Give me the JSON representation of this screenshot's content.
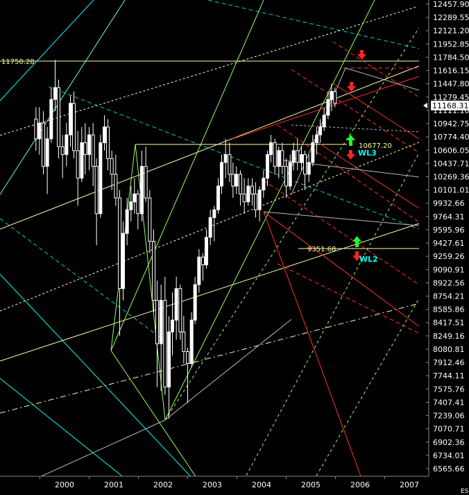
{
  "chart_data": {
    "type": "candlestick",
    "symbol": "ES",
    "y_ticks": [
      "12457.90",
      "12289.55",
      "12121.20",
      "11952.85",
      "11784.50",
      "11616.15",
      "11447.80",
      "11279.45",
      "11111.10",
      "10942.75",
      "10774.40",
      "10606.05",
      "10437.71",
      "10269.36",
      "10101.01",
      "9932.66",
      "9764.31",
      "9595.96",
      "9427.61",
      "9259.26",
      "9090.91",
      "8922.56",
      "8754.21",
      "8585.86",
      "8417.51",
      "8249.16",
      "8080.81",
      "7912.46",
      "7744.11",
      "7575.76",
      "7407.41",
      "7239.06",
      "7070.71",
      "6902.36",
      "6734.01",
      "6565.66"
    ],
    "x_ticks": [
      "2000",
      "2001",
      "2002",
      "2003",
      "2004",
      "2005",
      "2006",
      "2007"
    ],
    "ylim": [
      6565.66,
      12457.9
    ],
    "current_price": "11168.31",
    "levels": [
      {
        "label": "11750.28",
        "value": 11750.28
      },
      {
        "label": "10677.20",
        "value": 10677.2
      },
      {
        "label": "9351.68",
        "value": 9351.68
      }
    ],
    "wave_labels": [
      "WL3",
      "WL2"
    ],
    "candles": [
      [
        1999.92,
        11000,
        11150,
        10600,
        10750
      ],
      [
        1999.99,
        10750,
        11150,
        10550,
        10950
      ],
      [
        2000.07,
        10950,
        11100,
        10300,
        10400
      ],
      [
        2000.15,
        10400,
        10900,
        10050,
        10750
      ],
      [
        2000.23,
        10750,
        11400,
        10700,
        11250
      ],
      [
        2000.31,
        11250,
        11750,
        11100,
        11400
      ],
      [
        2000.38,
        11400,
        11500,
        10500,
        10650
      ],
      [
        2000.46,
        10650,
        10800,
        10250,
        10550
      ],
      [
        2000.54,
        10550,
        10950,
        10400,
        10800
      ],
      [
        2000.62,
        10800,
        11300,
        10650,
        11200
      ],
      [
        2000.69,
        11200,
        11350,
        10500,
        10600
      ],
      [
        2000.77,
        10600,
        10850,
        9900,
        10250
      ],
      [
        2000.85,
        10250,
        10900,
        10200,
        10700
      ],
      [
        2000.92,
        10700,
        10950,
        10300,
        10550
      ],
      [
        2001.0,
        10550,
        10900,
        10350,
        10800
      ],
      [
        2001.08,
        10800,
        10950,
        10150,
        10400
      ],
      [
        2001.15,
        10400,
        10500,
        9400,
        9800
      ],
      [
        2001.23,
        9800,
        10800,
        9750,
        10700
      ],
      [
        2001.31,
        10700,
        11050,
        10600,
        10900
      ],
      [
        2001.38,
        10900,
        11000,
        10350,
        10500
      ],
      [
        2001.46,
        10500,
        10600,
        10100,
        10300
      ],
      [
        2001.54,
        10300,
        10550,
        9900,
        10000
      ],
      [
        2001.62,
        10000,
        10100,
        8250,
        8850
      ],
      [
        2001.69,
        8850,
        9700,
        8700,
        9550
      ],
      [
        2001.77,
        9550,
        10000,
        9400,
        9850
      ],
      [
        2001.85,
        9850,
        10150,
        9700,
        9950
      ],
      [
        2001.92,
        9950,
        10250,
        9800,
        10050
      ],
      [
        2001.99,
        10050,
        10100,
        9600,
        9800
      ],
      [
        2002.07,
        9800,
        10600,
        9700,
        10400
      ],
      [
        2002.15,
        10400,
        10650,
        9950,
        10000
      ],
      [
        2002.23,
        10000,
        10100,
        9300,
        9450
      ],
      [
        2002.31,
        9450,
        9600,
        8550,
        8700
      ],
      [
        2002.38,
        8700,
        8950,
        7600,
        8150
      ],
      [
        2002.46,
        8150,
        8900,
        7550,
        8700
      ],
      [
        2002.54,
        8700,
        9000,
        7500,
        7600
      ],
      [
        2002.62,
        7600,
        8500,
        7200,
        8300
      ],
      [
        2002.69,
        8300,
        8800,
        8000,
        8450
      ],
      [
        2002.77,
        8450,
        9000,
        8200,
        8850
      ],
      [
        2002.85,
        8850,
        8900,
        8200,
        8300
      ],
      [
        2002.92,
        8300,
        8500,
        7900,
        8050
      ],
      [
        2003.0,
        8050,
        8100,
        7400,
        7900
      ],
      [
        2003.08,
        7900,
        8550,
        7850,
        8450
      ],
      [
        2003.15,
        8450,
        9000,
        8400,
        8900
      ],
      [
        2003.23,
        8900,
        9350,
        8800,
        9250
      ],
      [
        2003.31,
        9250,
        9300,
        8950,
        9150
      ],
      [
        2003.38,
        9150,
        9600,
        9100,
        9500
      ],
      [
        2003.46,
        9500,
        9850,
        9400,
        9750
      ],
      [
        2003.54,
        9750,
        9900,
        9450,
        9850
      ],
      [
        2003.62,
        9850,
        10250,
        9800,
        10150
      ],
      [
        2003.69,
        10150,
        10550,
        10050,
        10450
      ],
      [
        2003.77,
        10450,
        10750,
        10250,
        10550
      ],
      [
        2003.85,
        10550,
        10700,
        10200,
        10300
      ],
      [
        2003.92,
        10300,
        10450,
        10000,
        10150
      ],
      [
        2003.99,
        10150,
        10400,
        10050,
        10300
      ],
      [
        2004.07,
        10300,
        10350,
        9900,
        10050
      ],
      [
        2004.15,
        10050,
        10250,
        9800,
        9950
      ],
      [
        2004.23,
        9950,
        10250,
        9900,
        10150
      ],
      [
        2004.31,
        10150,
        10250,
        9900,
        10050
      ],
      [
        2004.38,
        10050,
        10200,
        9750,
        9850
      ],
      [
        2004.46,
        9850,
        10150,
        9700,
        10100
      ],
      [
        2004.54,
        10100,
        10350,
        10000,
        10250
      ],
      [
        2004.62,
        10250,
        10600,
        10150,
        10550
      ],
      [
        2004.69,
        10550,
        10800,
        10450,
        10700
      ],
      [
        2004.77,
        10700,
        10750,
        10300,
        10400
      ],
      [
        2004.85,
        10400,
        10650,
        10250,
        10600
      ],
      [
        2004.92,
        10600,
        10700,
        10300,
        10400
      ],
      [
        2005.0,
        10400,
        10500,
        10000,
        10150
      ],
      [
        2005.08,
        10150,
        10550,
        10100,
        10450
      ],
      [
        2005.15,
        10450,
        10700,
        10350,
        10600
      ],
      [
        2005.23,
        10600,
        10750,
        10350,
        10450
      ],
      [
        2005.31,
        10450,
        10650,
        10350,
        10550
      ],
      [
        2005.38,
        10550,
        10600,
        10100,
        10300
      ],
      [
        2005.46,
        10300,
        10550,
        10200,
        10450
      ],
      [
        2005.54,
        10450,
        10800,
        10400,
        10700
      ],
      [
        2005.62,
        10700,
        10900,
        10550,
        10800
      ],
      [
        2005.69,
        10800,
        11000,
        10700,
        10900
      ],
      [
        2005.77,
        10900,
        11150,
        10850,
        11050
      ],
      [
        2005.85,
        11050,
        11350,
        11000,
        11250
      ],
      [
        2005.92,
        11250,
        11450,
        11100,
        11350
      ],
      [
        2005.99,
        11350,
        11400,
        11150,
        11200
      ]
    ]
  }
}
